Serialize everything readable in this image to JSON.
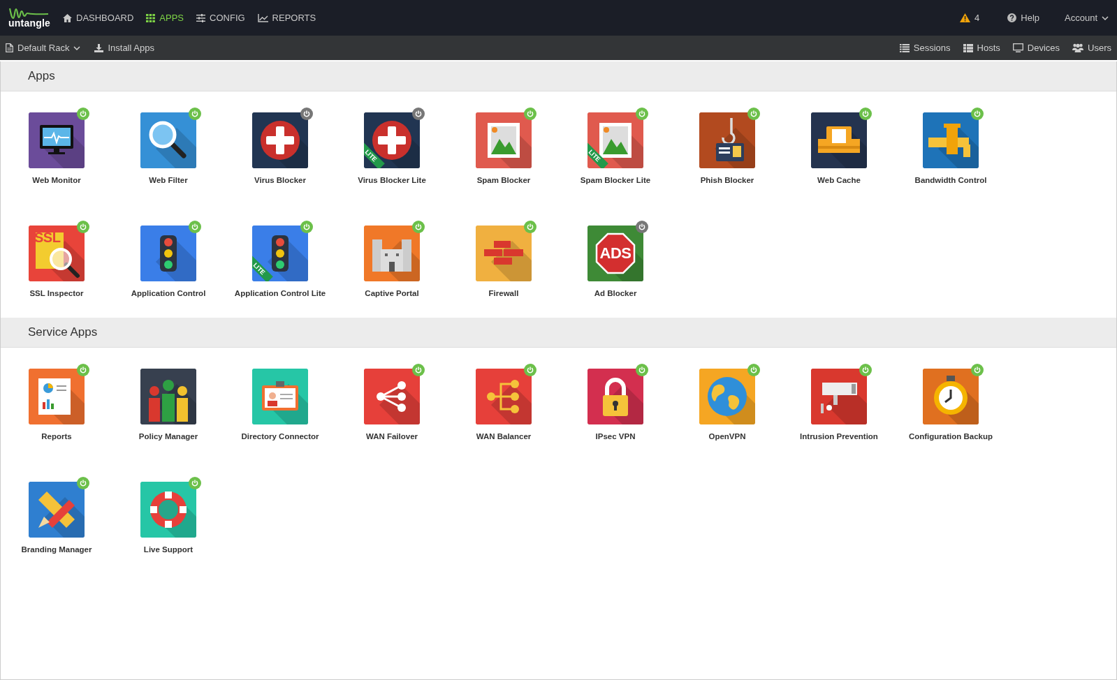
{
  "topbar": {
    "logo": "untangle",
    "nav": [
      {
        "label": "DASHBOARD",
        "selected": false
      },
      {
        "label": "APPS",
        "selected": true
      },
      {
        "label": "CONFIG",
        "selected": false
      },
      {
        "label": "REPORTS",
        "selected": false
      }
    ],
    "alerts": "4",
    "help": "Help",
    "account": "Account"
  },
  "toolbar": {
    "rack": "Default Rack",
    "install": "Install Apps",
    "links": [
      "Sessions",
      "Hosts",
      "Devices",
      "Users"
    ]
  },
  "sections": [
    {
      "title": "Apps",
      "apps": [
        {
          "label": "Web Monitor",
          "on": true
        },
        {
          "label": "Web Filter",
          "on": true
        },
        {
          "label": "Virus Blocker",
          "on": false
        },
        {
          "label": "Virus Blocker Lite",
          "on": false,
          "badge": "LITE"
        },
        {
          "label": "Spam Blocker",
          "on": true
        },
        {
          "label": "Spam Blocker Lite",
          "on": true,
          "badge": "LITE"
        },
        {
          "label": "Phish Blocker",
          "on": true
        },
        {
          "label": "Web Cache",
          "on": true
        },
        {
          "label": "Bandwidth Control",
          "on": true
        },
        {
          "label": "SSL Inspector",
          "on": true,
          "icon_text": "SSL"
        },
        {
          "label": "Application Control",
          "on": true
        },
        {
          "label": "Application Control Lite",
          "on": true,
          "badge": "LITE"
        },
        {
          "label": "Captive Portal",
          "on": true
        },
        {
          "label": "Firewall",
          "on": true
        },
        {
          "label": "Ad Blocker",
          "on": false,
          "icon_text": "ADS"
        }
      ]
    },
    {
      "title": "Service Apps",
      "apps": [
        {
          "label": "Reports",
          "on": true
        },
        {
          "label": "Policy Manager"
        },
        {
          "label": "Directory Connector"
        },
        {
          "label": "WAN Failover",
          "on": true
        },
        {
          "label": "WAN Balancer",
          "on": true
        },
        {
          "label": "IPsec VPN",
          "on": true
        },
        {
          "label": "OpenVPN",
          "on": true
        },
        {
          "label": "Intrusion Prevention",
          "on": true
        },
        {
          "label": "Configuration Backup",
          "on": true
        },
        {
          "label": "Branding Manager",
          "on": true
        },
        {
          "label": "Live Support",
          "on": true
        }
      ]
    }
  ]
}
